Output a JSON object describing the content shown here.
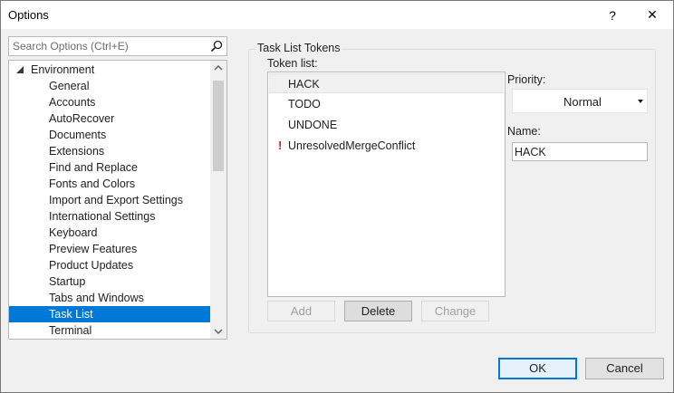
{
  "window": {
    "title": "Options",
    "help_label": "?",
    "close_label": "✕"
  },
  "search": {
    "placeholder": "Search Options (Ctrl+E)"
  },
  "tree": {
    "root": "Environment",
    "items": [
      {
        "label": "General"
      },
      {
        "label": "Accounts"
      },
      {
        "label": "AutoRecover"
      },
      {
        "label": "Documents"
      },
      {
        "label": "Extensions"
      },
      {
        "label": "Find and Replace"
      },
      {
        "label": "Fonts and Colors"
      },
      {
        "label": "Import and Export Settings"
      },
      {
        "label": "International Settings"
      },
      {
        "label": "Keyboard"
      },
      {
        "label": "Preview Features"
      },
      {
        "label": "Product Updates"
      },
      {
        "label": "Startup"
      },
      {
        "label": "Tabs and Windows"
      },
      {
        "label": "Task List",
        "selected": true
      },
      {
        "label": "Terminal"
      }
    ]
  },
  "task_list": {
    "group_title": "Task List Tokens",
    "token_list_label": "Token list:",
    "tokens": [
      {
        "name": "HACK",
        "selected": true,
        "high_priority": false
      },
      {
        "name": "TODO",
        "selected": false,
        "high_priority": false
      },
      {
        "name": "UNDONE",
        "selected": false,
        "high_priority": false
      },
      {
        "name": "UnresolvedMergeConflict",
        "selected": false,
        "high_priority": true
      }
    ],
    "high_priority_mark": "!",
    "buttons": {
      "add": "Add",
      "delete": "Delete",
      "change": "Change"
    },
    "priority_label": "Priority:",
    "priority_value": "Normal",
    "name_label": "Name:",
    "name_value": "HACK"
  },
  "footer": {
    "ok": "OK",
    "cancel": "Cancel"
  },
  "colors": {
    "selection": "#0078d7",
    "high_priority": "#e51400"
  }
}
